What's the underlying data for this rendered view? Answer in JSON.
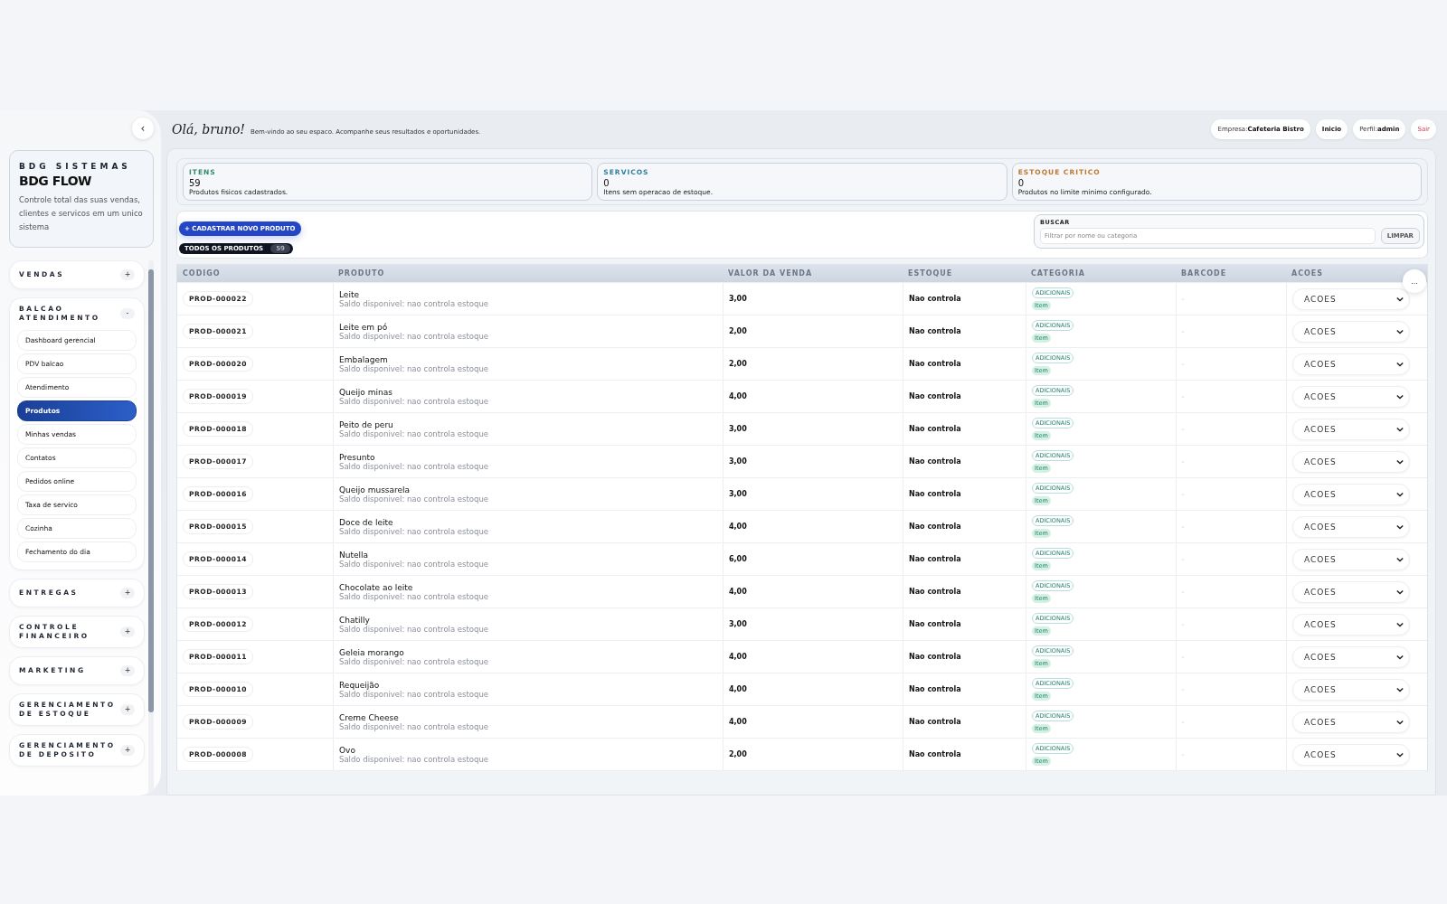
{
  "sidebar": {
    "collapse_button": "‹",
    "brand": {
      "eyebrow": "BDG SISTEMAS",
      "title": "BDG FLOW",
      "description": "Controle total das suas vendas, clientes e servicos em um unico sistema"
    },
    "groups": [
      {
        "label": "VENDAS",
        "toggle": "+"
      },
      {
        "label": "BALCAO ATENDIMENTO",
        "toggle": "-",
        "items": [
          {
            "label": "Dashboard gerencial",
            "selected": false
          },
          {
            "label": "PDV balcao",
            "selected": false
          },
          {
            "label": "Atendimento",
            "selected": false
          },
          {
            "label": "Produtos",
            "selected": true
          },
          {
            "label": "Minhas vendas",
            "selected": false
          },
          {
            "label": "Contatos",
            "selected": false
          },
          {
            "label": "Pedidos online",
            "selected": false
          },
          {
            "label": "Taxa de servico",
            "selected": false
          },
          {
            "label": "Cozinha",
            "selected": false
          },
          {
            "label": "Fechamento do dia",
            "selected": false
          }
        ]
      },
      {
        "label": "ENTREGAS",
        "toggle": "+"
      },
      {
        "label": "CONTROLE FINANCEIRO",
        "toggle": "+"
      },
      {
        "label": "MARKETING",
        "toggle": "+"
      },
      {
        "label": "GERENCIAMENTO DE ESTOQUE",
        "toggle": "+"
      },
      {
        "label": "GERENCIAMENTO DE DEPOSITO",
        "toggle": "+"
      }
    ]
  },
  "header": {
    "greeting": "Olá, bruno!",
    "subtitle": "Bem-vindo ao seu espaco. Acompanhe seus resultados e oportunidades.",
    "company": {
      "label": "Empresa:",
      "value": "Cafeteria Bistro"
    },
    "home": "Inicio",
    "profile": {
      "label": "Perfil:",
      "value": "admin"
    },
    "logout": "Sair"
  },
  "stats": [
    {
      "label": "ITENS",
      "value": "59",
      "description": "Produtos fisicos cadastrados.",
      "color": "#2e8a6e"
    },
    {
      "label": "SERVICOS",
      "value": "0",
      "description": "Itens sem operacao de estoque.",
      "color": "#2f7f9a"
    },
    {
      "label": "ESTOQUE CRITICO",
      "value": "0",
      "description": "Produtos no limite minimo configurado.",
      "color": "#c0782e"
    }
  ],
  "toolbar": {
    "new_button": "+ CADASTRAR NOVO PRODUTO",
    "filter_chip": {
      "label": "TODOS OS PRODUTOS",
      "count": "59",
      "selected": true
    },
    "search": {
      "label": "BUSCAR",
      "placeholder": "Filtrar por nome ou categoria"
    },
    "clear_button": "LIMPAR"
  },
  "table": {
    "more_button": "...",
    "columns": [
      "CODIGO",
      "PRODUTO",
      "VALOR DA VENDA",
      "ESTOQUE",
      "CATEGORIA",
      "BARCODE",
      "ACOES"
    ],
    "rows": [
      {
        "code": "PROD-000022",
        "name": "Leite",
        "stock_note": "Saldo disponivel: nao controla estoque",
        "price": "3,00",
        "stock": "Nao controla",
        "category": "ADICIONAIS",
        "type": "Item",
        "barcode": "-",
        "action": "ACOES"
      },
      {
        "code": "PROD-000021",
        "name": "Leite em pó",
        "stock_note": "Saldo disponivel: nao controla estoque",
        "price": "2,00",
        "stock": "Nao controla",
        "category": "ADICIONAIS",
        "type": "Item",
        "barcode": "-",
        "action": "ACOES"
      },
      {
        "code": "PROD-000020",
        "name": "Embalagem",
        "stock_note": "Saldo disponivel: nao controla estoque",
        "price": "2,00",
        "stock": "Nao controla",
        "category": "ADICIONAIS",
        "type": "Item",
        "barcode": "-",
        "action": "ACOES"
      },
      {
        "code": "PROD-000019",
        "name": "Queijo minas",
        "stock_note": "Saldo disponivel: nao controla estoque",
        "price": "4,00",
        "stock": "Nao controla",
        "category": "ADICIONAIS",
        "type": "Item",
        "barcode": "-",
        "action": "ACOES"
      },
      {
        "code": "PROD-000018",
        "name": "Peito de peru",
        "stock_note": "Saldo disponivel: nao controla estoque",
        "price": "3,00",
        "stock": "Nao controla",
        "category": "ADICIONAIS",
        "type": "Item",
        "barcode": "-",
        "action": "ACOES"
      },
      {
        "code": "PROD-000017",
        "name": "Presunto",
        "stock_note": "Saldo disponivel: nao controla estoque",
        "price": "3,00",
        "stock": "Nao controla",
        "category": "ADICIONAIS",
        "type": "Item",
        "barcode": "-",
        "action": "ACOES"
      },
      {
        "code": "PROD-000016",
        "name": "Queijo mussarela",
        "stock_note": "Saldo disponivel: nao controla estoque",
        "price": "3,00",
        "stock": "Nao controla",
        "category": "ADICIONAIS",
        "type": "Item",
        "barcode": "-",
        "action": "ACOES"
      },
      {
        "code": "PROD-000015",
        "name": "Doce de leite",
        "stock_note": "Saldo disponivel: nao controla estoque",
        "price": "4,00",
        "stock": "Nao controla",
        "category": "ADICIONAIS",
        "type": "Item",
        "barcode": "-",
        "action": "ACOES"
      },
      {
        "code": "PROD-000014",
        "name": "Nutella",
        "stock_note": "Saldo disponivel: nao controla estoque",
        "price": "6,00",
        "stock": "Nao controla",
        "category": "ADICIONAIS",
        "type": "Item",
        "barcode": "-",
        "action": "ACOES"
      },
      {
        "code": "PROD-000013",
        "name": "Chocolate ao leite",
        "stock_note": "Saldo disponivel: nao controla estoque",
        "price": "4,00",
        "stock": "Nao controla",
        "category": "ADICIONAIS",
        "type": "Item",
        "barcode": "-",
        "action": "ACOES"
      },
      {
        "code": "PROD-000012",
        "name": "Chatilly",
        "stock_note": "Saldo disponivel: nao controla estoque",
        "price": "3,00",
        "stock": "Nao controla",
        "category": "ADICIONAIS",
        "type": "Item",
        "barcode": "-",
        "action": "ACOES"
      },
      {
        "code": "PROD-000011",
        "name": "Geleia morango",
        "stock_note": "Saldo disponivel: nao controla estoque",
        "price": "4,00",
        "stock": "Nao controla",
        "category": "ADICIONAIS",
        "type": "Item",
        "barcode": "-",
        "action": "ACOES"
      },
      {
        "code": "PROD-000010",
        "name": "Requeijão",
        "stock_note": "Saldo disponivel: nao controla estoque",
        "price": "4,00",
        "stock": "Nao controla",
        "category": "ADICIONAIS",
        "type": "Item",
        "barcode": "-",
        "action": "ACOES"
      },
      {
        "code": "PROD-000009",
        "name": "Creme Cheese",
        "stock_note": "Saldo disponivel: nao controla estoque",
        "price": "4,00",
        "stock": "Nao controla",
        "category": "ADICIONAIS",
        "type": "Item",
        "barcode": "-",
        "action": "ACOES"
      },
      {
        "code": "PROD-000008",
        "name": "Ovo",
        "stock_note": "Saldo disponivel: nao controla estoque",
        "price": "2,00",
        "stock": "Nao controla",
        "category": "ADICIONAIS",
        "type": "Item",
        "barcode": "-",
        "action": "ACOES"
      }
    ]
  }
}
